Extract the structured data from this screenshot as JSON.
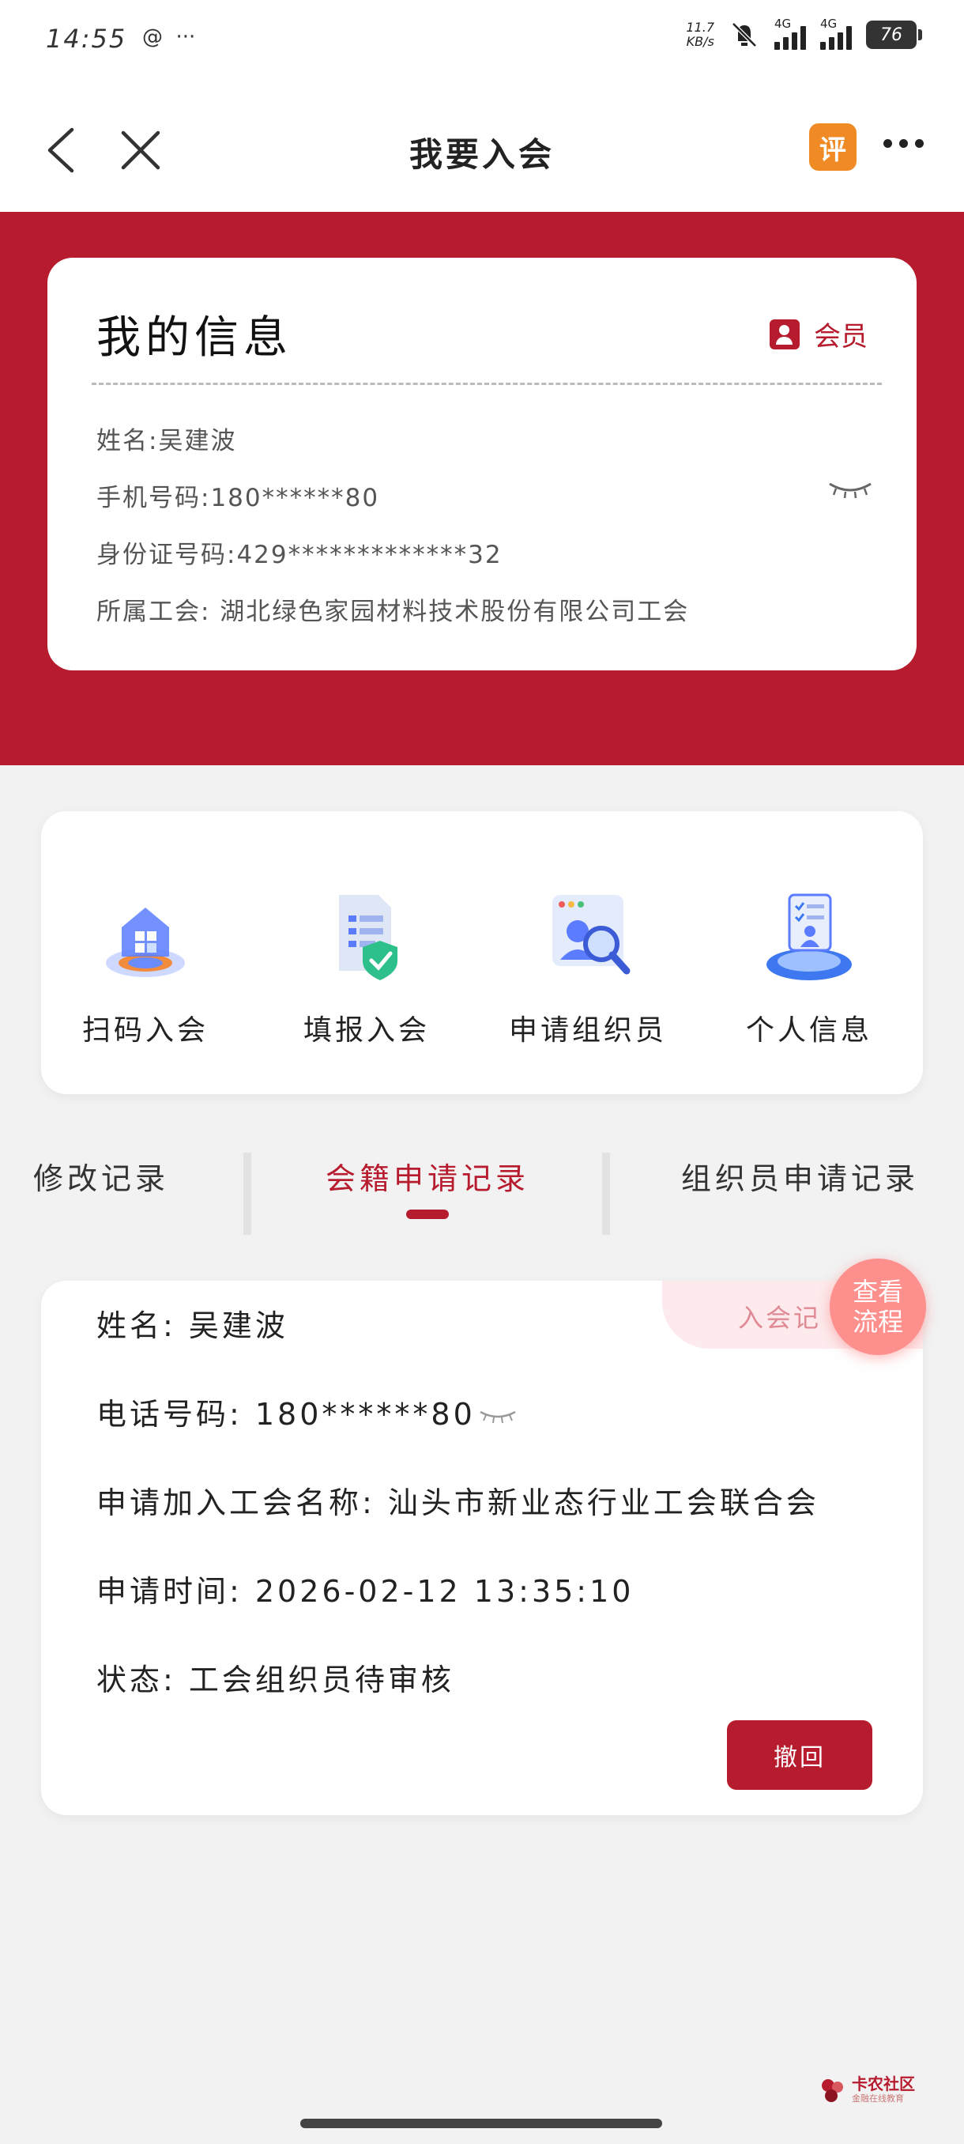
{
  "status_bar": {
    "time": "14:55",
    "speed_value": "11.7",
    "speed_unit": "KB/s",
    "network_1": "4G",
    "network_2": "4G",
    "battery": "76"
  },
  "header": {
    "title": "我要入会",
    "rate_label": "评"
  },
  "my_info": {
    "title": "我的信息",
    "badge": "会员",
    "name": "姓名:吴建波",
    "phone": "手机号码:180******80",
    "id_card": "身份证号码:429*************32",
    "union": "所属工会:  湖北绿色家园材料技术股份有限公司工会"
  },
  "quick_actions": [
    {
      "label": "扫码入会",
      "icon": "scan-join-icon"
    },
    {
      "label": "填报入会",
      "icon": "form-shield-icon"
    },
    {
      "label": "申请组织员",
      "icon": "search-person-icon"
    },
    {
      "label": "个人信息",
      "icon": "profile-document-icon"
    }
  ],
  "tabs": [
    {
      "label": "修改记录",
      "active": false
    },
    {
      "label": "会籍申请记录",
      "active": true
    },
    {
      "label": "组织员申请记录",
      "active": false
    }
  ],
  "record": {
    "ribbon": "入会记",
    "name": "姓名: 吴建波",
    "phone": "电话号码: 180******80",
    "union": "申请加入工会名称: 汕头市新业态行业工会联合会",
    "time": "申请时间: 2026-02-12 13:35:10",
    "status": "状态: 工会组织员待审核",
    "revoke_label": "撤回",
    "flow_line1": "查看",
    "flow_line2": "流程"
  },
  "watermark": {
    "line1": "卡农社区",
    "line2": "金融在线教育"
  },
  "colors": {
    "brand_red": "#b71c2e",
    "flow_pink": "#fd8f8d",
    "rate_orange": "#f08a24"
  }
}
